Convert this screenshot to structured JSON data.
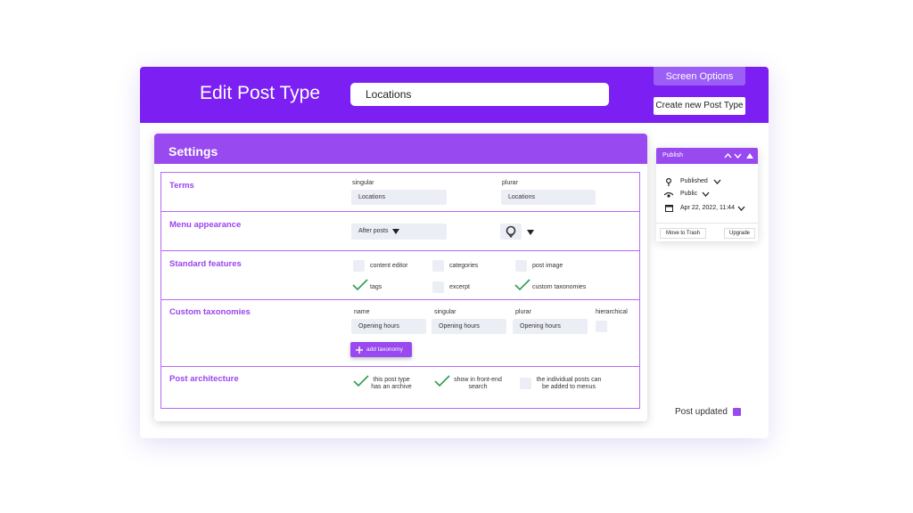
{
  "header": {
    "title": "Edit Post Type",
    "title_input_value": "Locations",
    "screen_options": "Screen Options",
    "create_button": "Create new Post Type"
  },
  "settings": {
    "title": "Settings",
    "terms": {
      "label": "Terms",
      "singular_label": "singular",
      "singular_value": "Locations",
      "plural_label": "plurar",
      "plural_value": "Locations"
    },
    "menu": {
      "label": "Menu appearance",
      "position_value": "After posts"
    },
    "features": {
      "label": "Standard features",
      "items": [
        {
          "label": "content editor",
          "checked": false
        },
        {
          "label": "categories",
          "checked": false
        },
        {
          "label": "post image",
          "checked": false
        },
        {
          "label": "tags",
          "checked": true
        },
        {
          "label": "excerpt",
          "checked": false
        },
        {
          "label": "custom taxonomies",
          "checked": true
        }
      ]
    },
    "taxonomies": {
      "label": "Custom taxonomies",
      "columns": [
        "name",
        "singular",
        "plurar",
        "hierarchical"
      ],
      "row": {
        "name": "Opening hours",
        "singular": "Opening hours",
        "plural": "Opening hours",
        "hierarchical": false
      },
      "add_button": "add taxonomy"
    },
    "architecture": {
      "label": "Post architecture",
      "items": [
        {
          "label": "this post type has an archive",
          "checked": true
        },
        {
          "label": "show in front-end search",
          "checked": true
        },
        {
          "label": "the individual posts can be added to menus",
          "checked": false
        }
      ]
    }
  },
  "publish": {
    "title": "Publish",
    "status": "Published",
    "visibility": "Public",
    "date": "Apr 22, 2022, 11:44",
    "trash_button": "Move to Trash",
    "upgrade_button": "Upgrade"
  },
  "status_message": "Post updated",
  "colors": {
    "primary": "#7b1ff2",
    "accent": "#9849ef",
    "border": "#b56af5",
    "check": "#2e9e4f"
  }
}
